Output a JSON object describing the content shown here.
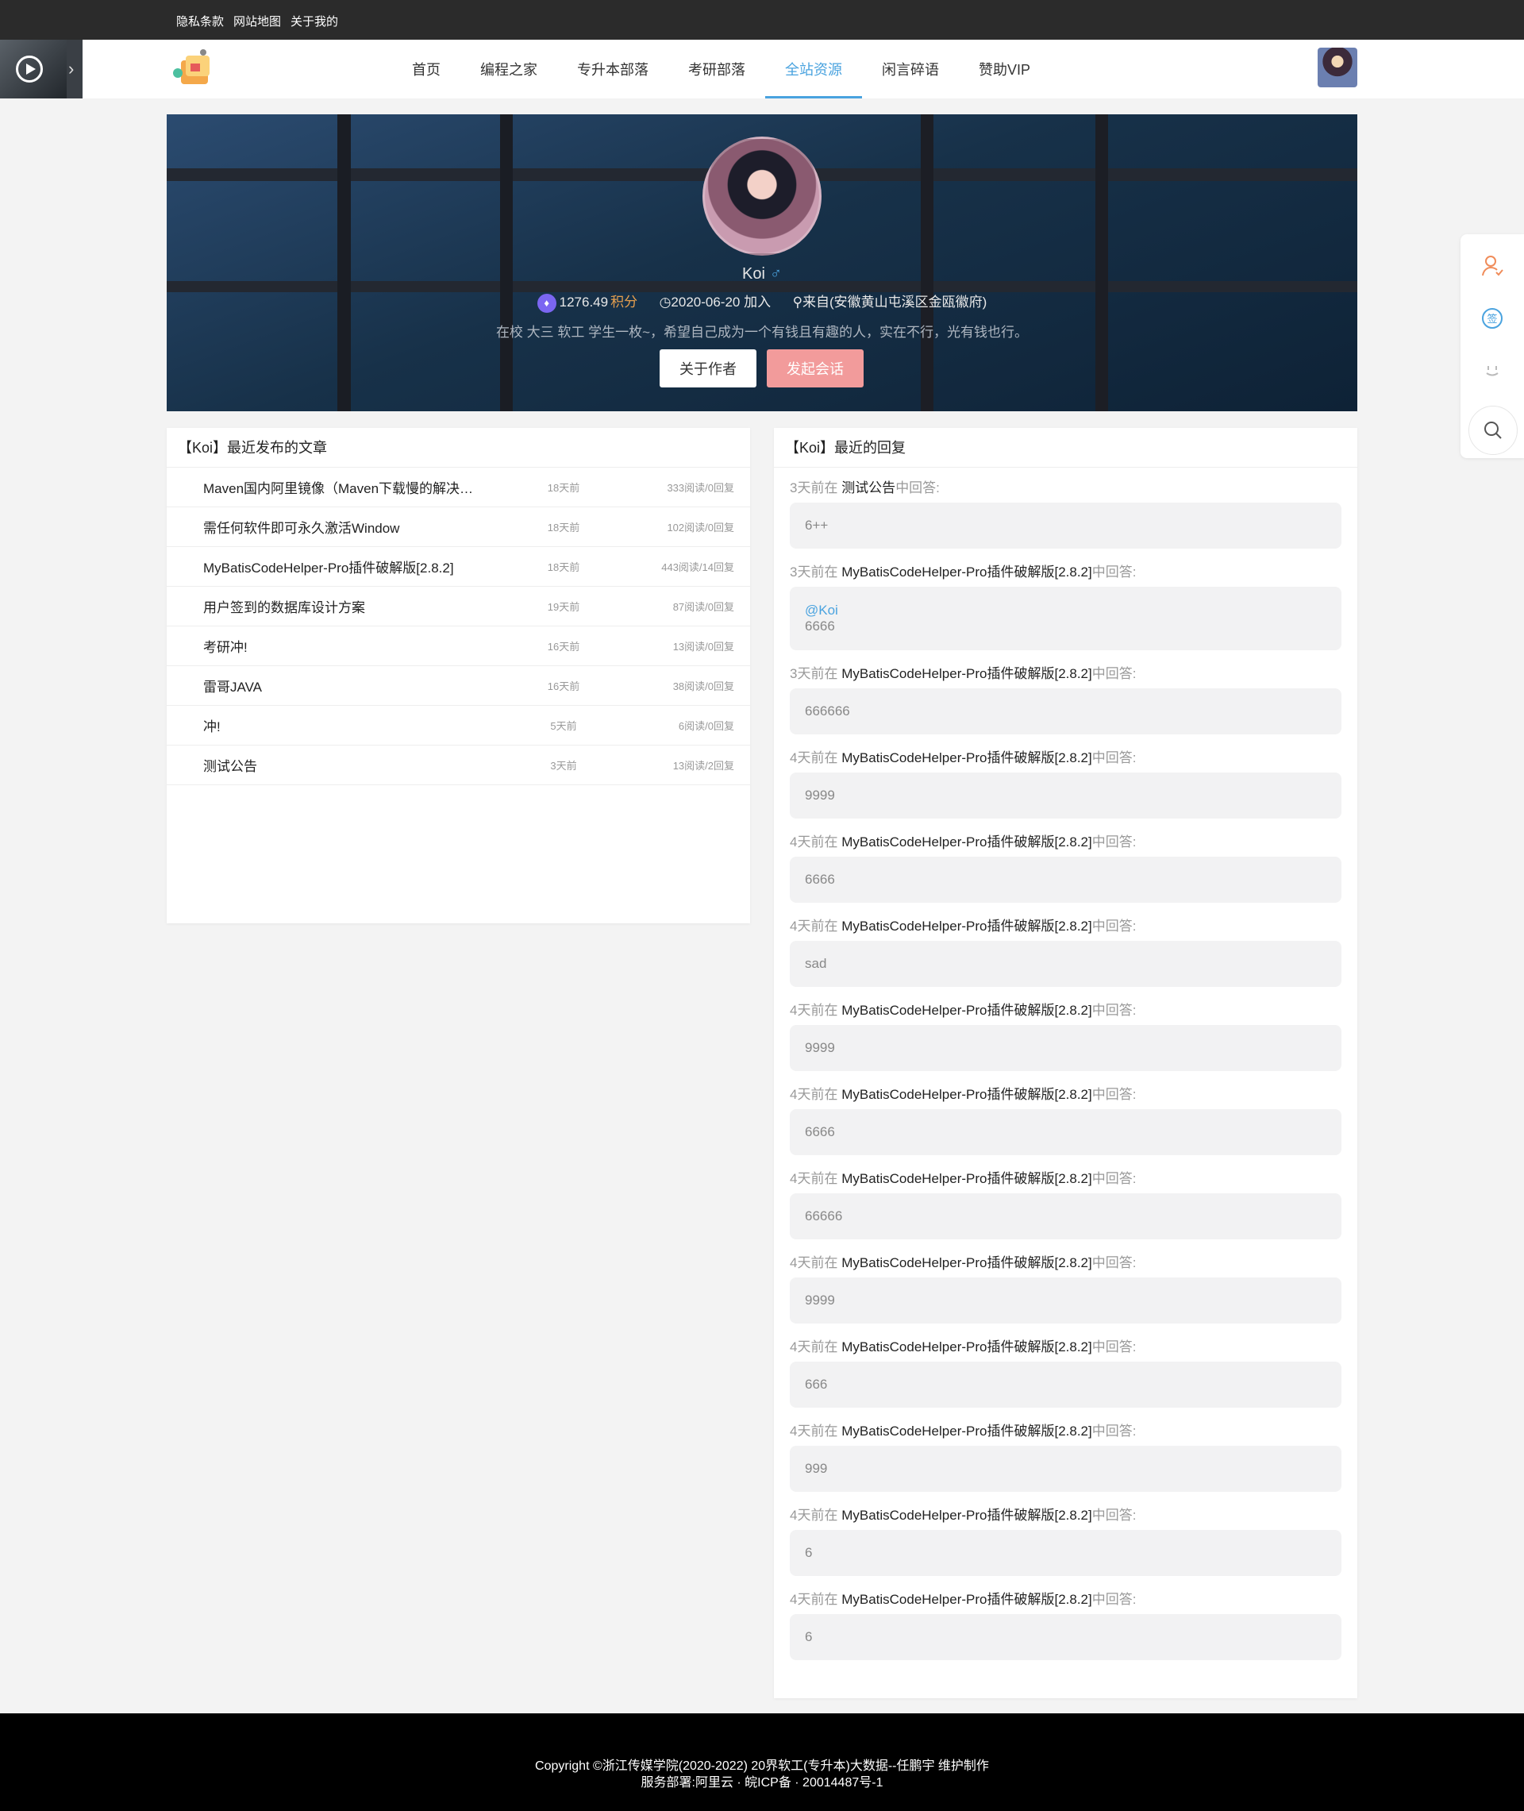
{
  "topbar": {
    "links": [
      "隐私条款",
      "网站地图",
      "关于我的"
    ]
  },
  "nav": {
    "items": [
      "首页",
      "编程之家",
      "专升本部落",
      "考研部落",
      "全站资源",
      "闲言碎语",
      "赞助VIP"
    ],
    "active": 4
  },
  "hero": {
    "name": "Koi",
    "gender_symbol": "♂",
    "points": "1276.49",
    "points_label": "积分",
    "joined": "2020-06-20 加入",
    "location": "来自(安徽黄山屯溪区金瓯徽府)",
    "bio": "在校 大三 软工 学生一枚~，希望自己成为一个有钱且有趣的人，实在不行，光有钱也行。",
    "btn_about": "关于作者",
    "btn_chat": "发起会话"
  },
  "articles": {
    "title": "【Koi】最近发布的文章",
    "rows": [
      {
        "title": "Maven国内阿里镜像（Maven下载慢的解决…",
        "date": "18天前",
        "stats": "333阅读/0回复"
      },
      {
        "title": "需任何软件即可永久激活Window",
        "date": "18天前",
        "stats": "102阅读/0回复"
      },
      {
        "title": "MyBatisCodeHelper-Pro插件破解版[2.8.2]",
        "date": "18天前",
        "stats": "443阅读/14回复"
      },
      {
        "title": "用户签到的数据库设计方案",
        "date": "19天前",
        "stats": "87阅读/0回复"
      },
      {
        "title": "考研冲!",
        "date": "16天前",
        "stats": "13阅读/0回复"
      },
      {
        "title": "雷哥JAVA",
        "date": "16天前",
        "stats": "38阅读/0回复"
      },
      {
        "title": "冲!",
        "date": "5天前",
        "stats": "6阅读/0回复"
      },
      {
        "title": "测试公告",
        "date": "3天前",
        "stats": "13阅读/2回复"
      }
    ]
  },
  "replies": {
    "title": "【Koi】最近的回复",
    "in_label": "中回答:",
    "items": [
      {
        "when": "3天前在 ",
        "article": "测试公告",
        "content": "6++"
      },
      {
        "when": "3天前在 ",
        "article": "MyBatisCodeHelper-Pro插件破解版[2.8.2]",
        "mention": "@Koi",
        "content": "6666"
      },
      {
        "when": "3天前在 ",
        "article": "MyBatisCodeHelper-Pro插件破解版[2.8.2]",
        "content": "666666"
      },
      {
        "when": "4天前在 ",
        "article": "MyBatisCodeHelper-Pro插件破解版[2.8.2]",
        "content": "9999"
      },
      {
        "when": "4天前在 ",
        "article": "MyBatisCodeHelper-Pro插件破解版[2.8.2]",
        "content": "6666"
      },
      {
        "when": "4天前在 ",
        "article": "MyBatisCodeHelper-Pro插件破解版[2.8.2]",
        "content": "sad"
      },
      {
        "when": "4天前在 ",
        "article": "MyBatisCodeHelper-Pro插件破解版[2.8.2]",
        "content": "9999"
      },
      {
        "when": "4天前在 ",
        "article": "MyBatisCodeHelper-Pro插件破解版[2.8.2]",
        "content": "6666"
      },
      {
        "when": "4天前在 ",
        "article": "MyBatisCodeHelper-Pro插件破解版[2.8.2]",
        "content": "66666"
      },
      {
        "when": "4天前在 ",
        "article": "MyBatisCodeHelper-Pro插件破解版[2.8.2]",
        "content": "9999"
      },
      {
        "when": "4天前在 ",
        "article": "MyBatisCodeHelper-Pro插件破解版[2.8.2]",
        "content": "666"
      },
      {
        "when": "4天前在 ",
        "article": "MyBatisCodeHelper-Pro插件破解版[2.8.2]",
        "content": "999"
      },
      {
        "when": "4天前在 ",
        "article": "MyBatisCodeHelper-Pro插件破解版[2.8.2]",
        "content": "6"
      },
      {
        "when": "4天前在 ",
        "article": "MyBatisCodeHelper-Pro插件破解版[2.8.2]",
        "content": "6"
      }
    ]
  },
  "floatbar": {
    "icons": [
      "user-icon",
      "sign-in-icon",
      "face-icon",
      "search-icon"
    ],
    "sign_glyph": "签"
  },
  "footer": {
    "line1": "Copyright ©浙江传媒学院(2020-2022) 20界软工(专升本)大数据--任鹏宇 维护制作",
    "line2": "服务部署:阿里云 · 皖ICP备 · 20014487号-1"
  },
  "colors": {
    "accent": "#4aa3df",
    "points": "#e7a04f",
    "chat_button": "#f29b9b"
  }
}
